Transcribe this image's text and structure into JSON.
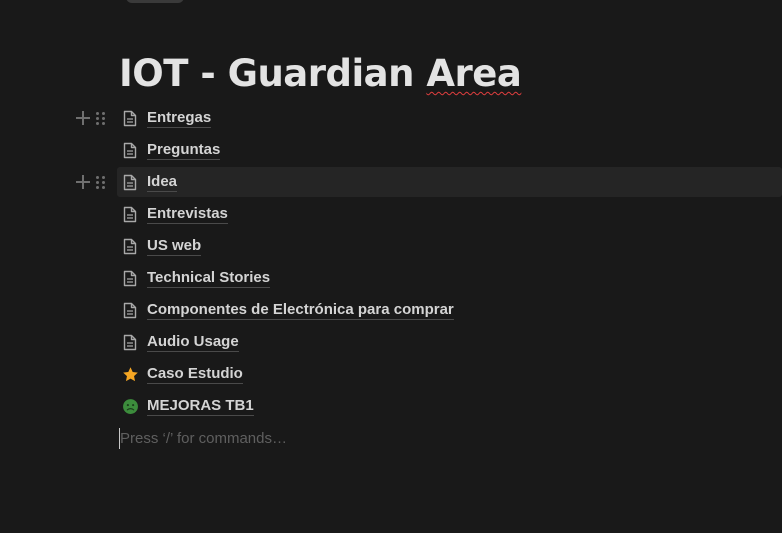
{
  "page": {
    "title_prefix": "IOT - Guardian ",
    "title_misspelled": "Area"
  },
  "pages": [
    {
      "label": "Entregas",
      "icon": "page-icon"
    },
    {
      "label": "Preguntas",
      "icon": "page-icon"
    },
    {
      "label": "Idea",
      "icon": "page-icon"
    },
    {
      "label": "Entrevistas",
      "icon": "page-icon"
    },
    {
      "label": "US web",
      "icon": "page-icon"
    },
    {
      "label": "Technical Stories",
      "icon": "page-icon"
    },
    {
      "label": "Componentes de Electrónica para comprar",
      "icon": "page-icon"
    },
    {
      "label": "Audio Usage",
      "icon": "page-icon"
    },
    {
      "label": "Caso Estudio",
      "icon": "star-icon"
    },
    {
      "label": "MEJORAS TB1",
      "icon": "sick-face-icon"
    }
  ],
  "editor": {
    "placeholder": "Press ‘/’ for commands…"
  },
  "colors": {
    "background": "#191919",
    "hover_row": "#252525",
    "text": "#d4d4d4",
    "spellcheck": "#e03e3e",
    "star": "#f5a623",
    "sick_face": "#3c8c3c"
  }
}
